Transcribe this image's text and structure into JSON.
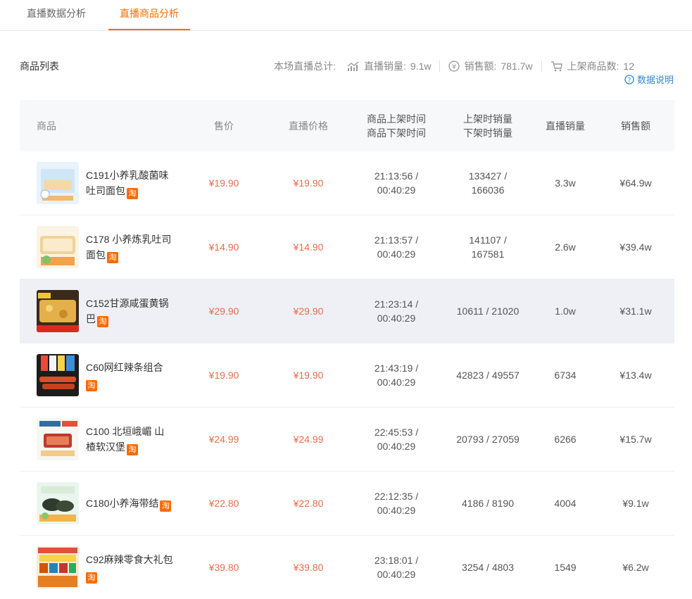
{
  "tabs": [
    {
      "label": "直播数据分析",
      "active": false
    },
    {
      "label": "直播商品分析",
      "active": true
    }
  ],
  "header": {
    "list_title": "商品列表",
    "summary_prefix": "本场直播总计:",
    "live_sales_label": "直播销量:",
    "live_sales_value": "9.1w",
    "amount_label": "销售额:",
    "amount_value": "781.7w",
    "items_label": "上架商品数:",
    "items_value": "12",
    "help_label": "数据说明"
  },
  "table": {
    "columns": {
      "product": "商品",
      "price": "售价",
      "live_price": "直播价格",
      "time_on": "商品上架时间",
      "time_off": "商品下架时间",
      "sales_on": "上架时销量",
      "sales_off": "下架时销量",
      "live_volume": "直播销量",
      "amount": "销售额"
    },
    "badge": "淘",
    "rows": [
      {
        "name": "C191小养乳酸菌味吐司面包",
        "price": "¥19.90",
        "live_price": "¥19.90",
        "time": "21:13:56 / 00:40:29",
        "sales": "133427 / 166036",
        "volume": "3.3w",
        "amount": "¥64.9w",
        "thumb": "bread-box"
      },
      {
        "name": "C178 小养炼乳吐司面包",
        "price": "¥14.90",
        "live_price": "¥14.90",
        "time": "21:13:57 / 00:40:29",
        "sales": "141107 / 167581",
        "volume": "2.6w",
        "amount": "¥39.4w",
        "thumb": "bread"
      },
      {
        "name": "C152甘源咸蛋黄锅巴",
        "price": "¥29.90",
        "live_price": "¥29.90",
        "time": "21:23:14 / 00:40:29",
        "sales": "10611 / 21020",
        "volume": "1.0w",
        "amount": "¥31.1w",
        "thumb": "crisps"
      },
      {
        "name": "C60网红辣条组合",
        "price": "¥19.90",
        "live_price": "¥19.90",
        "time": "21:43:19 / 00:40:29",
        "sales": "42823 / 49557",
        "volume": "6734",
        "amount": "¥13.4w",
        "thumb": "spicy-strips"
      },
      {
        "name": "C100 北垣峨嵋 山楂软汉堡",
        "price": "¥24.99",
        "live_price": "¥24.99",
        "time": "22:45:53 / 00:40:29",
        "sales": "20793 / 27059",
        "volume": "6266",
        "amount": "¥15.7w",
        "thumb": "hawthorn"
      },
      {
        "name": "C180小养海带结",
        "price": "¥22.80",
        "live_price": "¥22.80",
        "time": "22:12:35 / 00:40:29",
        "sales": "4186 / 8190",
        "volume": "4004",
        "amount": "¥9.1w",
        "thumb": "seaweed"
      },
      {
        "name": "C92麻辣零食大礼包",
        "price": "¥39.80",
        "live_price": "¥39.80",
        "time": "23:18:01 / 00:40:29",
        "sales": "3254 / 4803",
        "volume": "1549",
        "amount": "¥6.2w",
        "thumb": "snack-pack"
      }
    ]
  }
}
